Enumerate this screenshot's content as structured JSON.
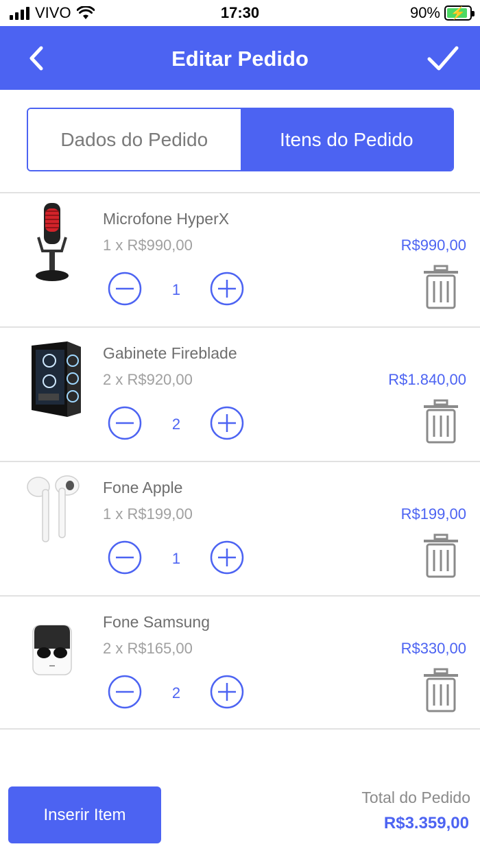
{
  "status_bar": {
    "carrier": "VIVO",
    "time": "17:30",
    "battery": "90%",
    "battery_level": 0.9
  },
  "header": {
    "title": "Editar Pedido",
    "back_icon": "chevron-left-icon",
    "confirm_icon": "checkmark-icon"
  },
  "tabs": [
    {
      "label": "Dados do Pedido",
      "active": false
    },
    {
      "label": "Itens do Pedido",
      "active": true
    }
  ],
  "items": [
    {
      "name": "Microfone HyperX",
      "unit_line": "1 x R$990,00",
      "total": "R$990,00",
      "quantity": "1",
      "image": "microphone"
    },
    {
      "name": "Gabinete Fireblade",
      "unit_line": "2 x R$920,00",
      "total": "R$1.840,00",
      "quantity": "2",
      "image": "pc-case"
    },
    {
      "name": "Fone Apple",
      "unit_line": "1 x R$199,00",
      "total": "R$199,00",
      "quantity": "1",
      "image": "earbuds-white"
    },
    {
      "name": "Fone Samsung",
      "unit_line": "2 x R$165,00",
      "total": "R$330,00",
      "quantity": "2",
      "image": "earbuds-case"
    }
  ],
  "footer": {
    "insert_label": "Inserir Item",
    "total_label": "Total do Pedido",
    "total_value": "R$3.359,00"
  },
  "colors": {
    "accent": "#4c63f2",
    "divider": "#e1e1e1",
    "icon_gray": "#8a8a8a"
  }
}
